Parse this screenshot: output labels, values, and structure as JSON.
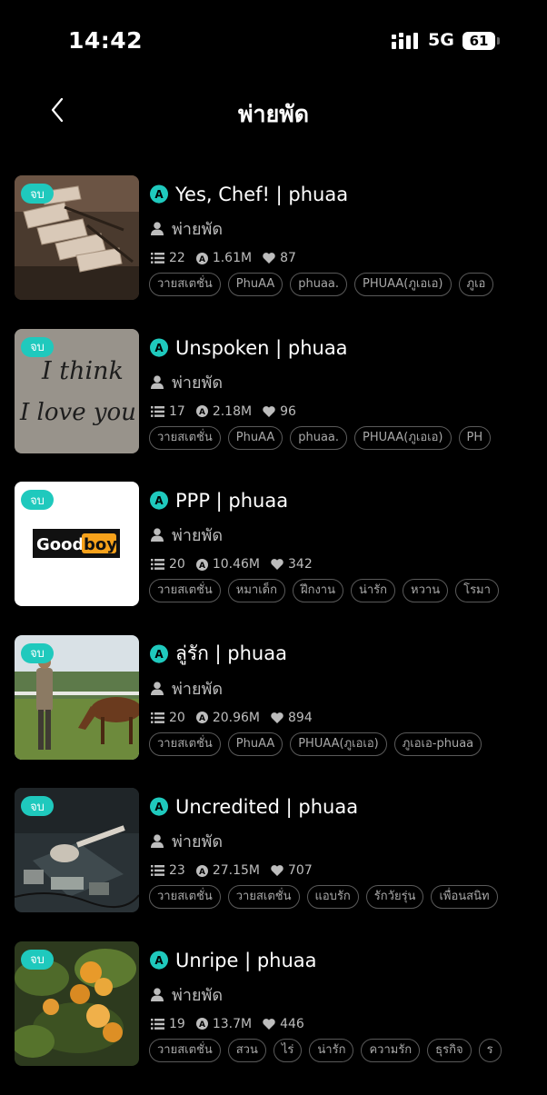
{
  "status_bar": {
    "time": "14:42",
    "network": "5G",
    "battery": "61"
  },
  "header": {
    "title": "พ่ายพัด"
  },
  "colors": {
    "accent": "#1fc9bd",
    "background": "#000000",
    "tag_border": "#5a5a5a"
  },
  "items": [
    {
      "badge": "จบ",
      "title": "Yes, Chef! | phuaa",
      "author": "พ่ายพัด",
      "chapters": "22",
      "views": "1.61M",
      "likes": "87",
      "cover": "paper-tags-cover",
      "tags": [
        "วายสเตชั่น",
        "PhuAA",
        "phuaa.",
        "PHUAA(ภูเอเอ)",
        "ภูเอ"
      ]
    },
    {
      "badge": "จบ",
      "title": "Unspoken | phuaa",
      "author": "พ่ายพัด",
      "chapters": "17",
      "views": "2.18M",
      "likes": "96",
      "cover": "handwriting-cover",
      "cover_text": [
        "I think",
        "I love you"
      ],
      "tags": [
        "วายสเตชั่น",
        "PhuAA",
        "phuaa.",
        "PHUAA(ภูเอเอ)",
        "PH"
      ]
    },
    {
      "badge": "จบ",
      "title": "PPP | phuaa",
      "author": "พ่ายพัด",
      "chapters": "20",
      "views": "10.46M",
      "likes": "342",
      "cover": "goodboy-cover",
      "cover_text": [
        "Good",
        "boy"
      ],
      "tags": [
        "วายสเตชั่น",
        "หมาเด็ก",
        "ฝึกงาน",
        "น่ารัก",
        "หวาน",
        "โรมา"
      ]
    },
    {
      "badge": "จบ",
      "title": "ลู่รัก | phuaa",
      "author": "พ่ายพัด",
      "chapters": "20",
      "views": "20.96M",
      "likes": "894",
      "cover": "horse-cover",
      "tags": [
        "วายสเตชั่น",
        "PhuAA",
        "PHUAA(ภูเอเอ)",
        "ภูเอเอ-phuaa"
      ]
    },
    {
      "badge": "จบ",
      "title": "Uncredited | phuaa",
      "author": "พ่ายพัด",
      "chapters": "23",
      "views": "27.15M",
      "likes": "707",
      "cover": "guitar-cover",
      "tags": [
        "วายสเตชั่น",
        "วายสเตชั่น",
        "แอบรัก",
        "รักวัยรุ่น",
        "เพื่อนสนิท"
      ]
    },
    {
      "badge": "จบ",
      "title": "Unripe | phuaa",
      "author": "พ่ายพัด",
      "chapters": "19",
      "views": "13.7M",
      "likes": "446",
      "cover": "orange-tree-cover",
      "tags": [
        "วายสเตชั่น",
        "สวน",
        "ไร่",
        "น่ารัก",
        "ความรัก",
        "ธุรกิจ",
        "ร"
      ]
    }
  ]
}
